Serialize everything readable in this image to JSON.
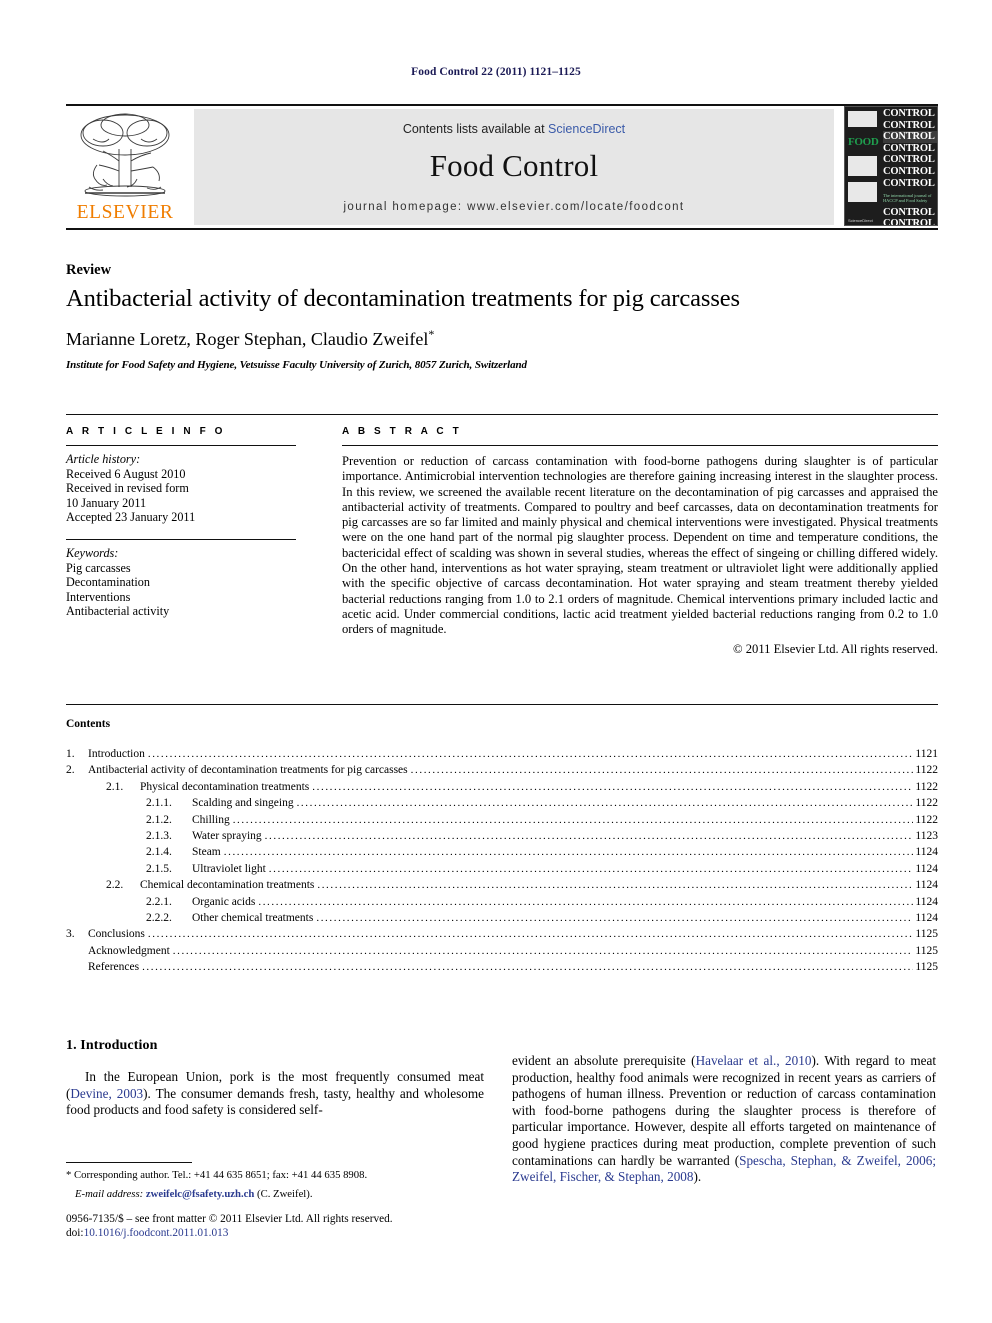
{
  "running_head": "Food Control 22 (2011) 1121–1125",
  "masthead": {
    "publisher_name": "ELSEVIER",
    "contents_prefix": "Contents lists available at ",
    "contents_link": "ScienceDirect",
    "journal_name": "Food Control",
    "homepage": "journal homepage: www.elsevier.com/locate/foodcont",
    "cover": {
      "food_word": "FOOD",
      "control_word": "CONTROL",
      "subtitle": "The international journal of HACCP and Food Safety",
      "publisher_footer": "ScienceDirect"
    }
  },
  "article": {
    "kind": "Review",
    "title": "Antibacterial activity of decontamination treatments for pig carcasses",
    "authors": "Marianne Loretz, Roger Stephan, Claudio Zweifel",
    "author_marker": "*",
    "affiliation": "Institute for Food Safety and Hygiene, Vetsuisse Faculty University of Zurich, 8057 Zurich, Switzerland"
  },
  "article_info": {
    "heading": "A R T I C L E   I N F O",
    "history_label": "Article history:",
    "history": [
      "Received 6 August 2010",
      "Received in revised form",
      "10 January 2011",
      "Accepted 23 January 2011"
    ],
    "keywords_label": "Keywords:",
    "keywords": [
      "Pig carcasses",
      "Decontamination",
      "Interventions",
      "Antibacterial activity"
    ]
  },
  "abstract": {
    "heading": "A B S T R A C T",
    "text": "Prevention or reduction of carcass contamination with food-borne pathogens during slaughter is of particular importance. Antimicrobial intervention technologies are therefore gaining increasing interest in the slaughter process. In this review, we screened the available recent literature on the decontamination of pig carcasses and appraised the antibacterial activity of treatments. Compared to poultry and beef carcasses, data on decontamination treatments for pig carcasses are so far limited and mainly physical and chemical interventions were investigated. Physical treatments were on the one hand part of the normal pig slaughter process. Dependent on time and temperature conditions, the bactericidal effect of scalding was shown in several studies, whereas the effect of singeing or chilling differed widely. On the other hand, interventions as hot water spraying, steam treatment or ultraviolet light were additionally applied with the specific objective of carcass decontamination. Hot water spraying and steam treatment thereby yielded bacterial reductions ranging from 1.0 to 2.1 orders of magnitude. Chemical interventions primary included lactic and acetic acid. Under commercial conditions, lactic acid treatment yielded bacterial reductions ranging from 0.2 to 1.0 orders of magnitude.",
    "copyright": "© 2011 Elsevier Ltd. All rights reserved."
  },
  "contents": {
    "title": "Contents",
    "entries": [
      {
        "level": 1,
        "num": "1.",
        "label": "Introduction",
        "page": "1121"
      },
      {
        "level": 1,
        "num": "2.",
        "label": "Antibacterial activity of decontamination treatments for pig carcasses",
        "page": "1122"
      },
      {
        "level": 2,
        "num": "2.1.",
        "label": "Physical decontamination treatments",
        "page": "1122"
      },
      {
        "level": 3,
        "num": "2.1.1.",
        "label": "Scalding and singeing",
        "page": "1122"
      },
      {
        "level": 3,
        "num": "2.1.2.",
        "label": "Chilling",
        "page": "1122"
      },
      {
        "level": 3,
        "num": "2.1.3.",
        "label": "Water spraying",
        "page": "1123"
      },
      {
        "level": 3,
        "num": "2.1.4.",
        "label": "Steam",
        "page": "1124"
      },
      {
        "level": 3,
        "num": "2.1.5.",
        "label": "Ultraviolet light",
        "page": "1124"
      },
      {
        "level": 2,
        "num": "2.2.",
        "label": "Chemical decontamination treatments",
        "page": "1124"
      },
      {
        "level": 3,
        "num": "2.2.1.",
        "label": "Organic acids",
        "page": "1124"
      },
      {
        "level": 3,
        "num": "2.2.2.",
        "label": "Other chemical treatments",
        "page": "1124"
      },
      {
        "level": 1,
        "num": "3.",
        "label": "Conclusions",
        "page": "1125"
      },
      {
        "level": 4,
        "num": "",
        "label": "Acknowledgment",
        "page": "1125"
      },
      {
        "level": 4,
        "num": "",
        "label": "References",
        "page": "1125"
      }
    ]
  },
  "body": {
    "section_title": "1.  Introduction",
    "left_paragraph": {
      "part1": "In the European Union, pork is the most frequently consumed meat (",
      "cite1": "Devine, 2003",
      "part2": "). The consumer demands fresh, tasty, healthy and wholesome food products and food safety is considered self-"
    },
    "right_paragraph": {
      "part1": "evident an absolute prerequisite (",
      "cite1": "Havelaar et al., 2010",
      "part2": "). With regard to meat production, healthy food animals were recognized in recent years as carriers of pathogens of human illness. Prevention or reduction of carcass contamination with food-borne pathogens during the slaughter process is therefore of particular importance. However, despite all efforts targeted on maintenance of good hygiene practices during meat production, complete prevention of such contaminations can hardly be warranted (",
      "cite2": "Spescha, Stephan, & Zweifel, 2006; Zweifel, Fischer, & Stephan, 2008",
      "part3": ")."
    }
  },
  "footnote": {
    "marker": "*",
    "corresponding": " Corresponding author. Tel.: +41 44 635 8651; fax: +41 44 635 8908.",
    "email_label": "E-mail address:",
    "email": "zweifelc@fsafety.uzh.ch",
    "email_suffix": " (C. Zweifel)."
  },
  "imprint": {
    "issn_line": "0956-7135/$ – see front matter © 2011 Elsevier Ltd. All rights reserved.",
    "doi_label": "doi:",
    "doi": "10.1016/j.foodcont.2011.01.013"
  }
}
